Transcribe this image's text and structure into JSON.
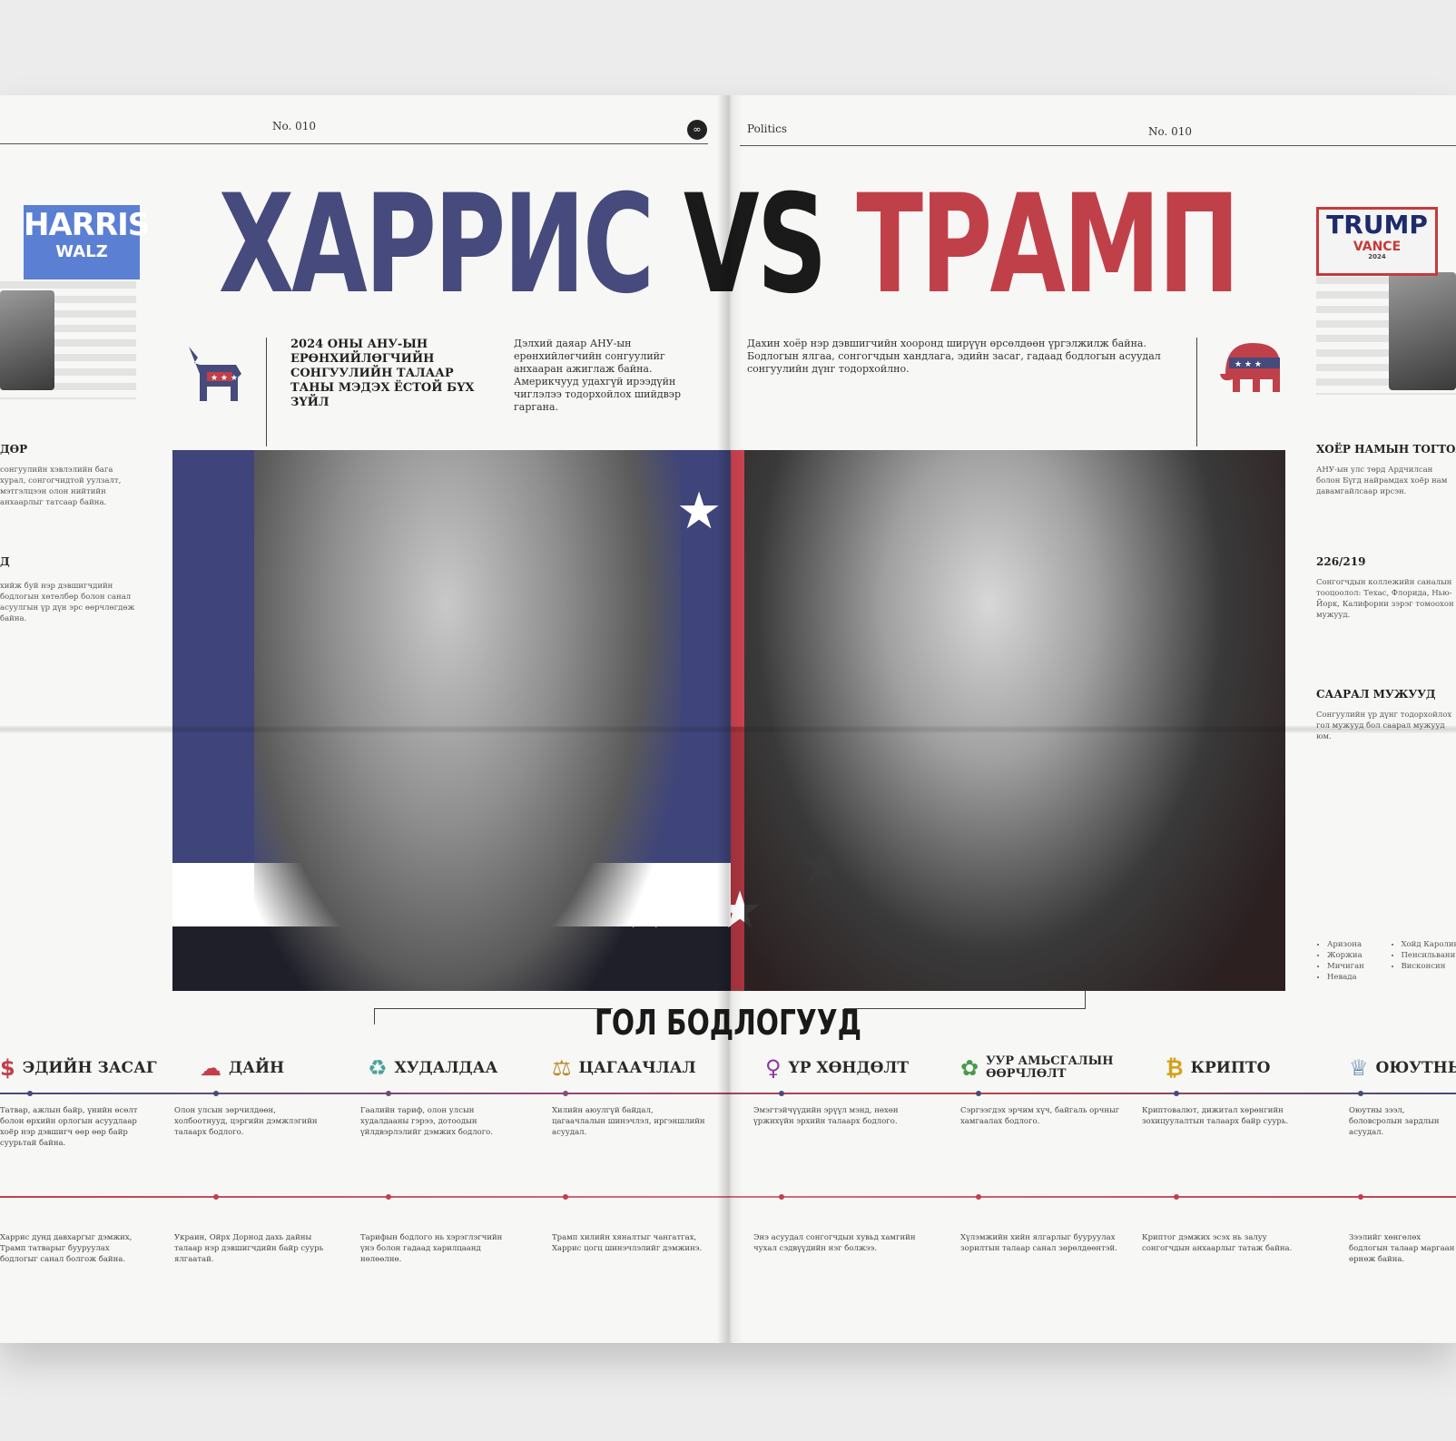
{
  "header": {
    "left_issue": "No. 010",
    "right_section": "Politics",
    "right_issue": "No. 010",
    "logo_glyph": "∞"
  },
  "title": {
    "harris": "ХАРРИС",
    "vs": "VS",
    "trump": "ТРАМП"
  },
  "signs": {
    "harris_line1": "HARRIS",
    "harris_line2": "WALZ",
    "trump_line1": "TRUMP",
    "trump_line2": "VANCE",
    "trump_line3": "2024"
  },
  "headline": "2024 ОНЫ АНУ-ЫН ЕРӨНХИЙЛӨГЧИЙН СОНГУУЛИЙН ТАЛААР ТАНЫ МЭДЭХ ЁСТОЙ БҮХ ЗҮЙЛ",
  "intro_left": "Дэлхий даяар АНУ-ын ерөнхийлөгчийн сонгуулийг анхааран ажиглаж байна. Америкчууд удахгүй ирээдүйн чиглэлээ тодорхойлох шийдвэр гаргана.",
  "intro_right": "Дахин хоёр нэр дэвшигчийн хооронд ширүүн өрсөлдөөн үргэлжилж байна. Бодлогын ялгаа, сонгогчдын хандлага, эдийн засаг, гадаад бодлогын асуудал сонгуулийн дүнг тодорхойлно.",
  "section_title": "ГОЛ БОДЛОГУУД",
  "policies": [
    {
      "icon": "$",
      "label": "ЭДИЙН ЗАСАГ",
      "text_top": "Татвар, ажлын байр, үнийн өсөлт болон өрхийн орлогын асуудлаар хоёр нэр дэвшигч өөр өөр байр суурьтай байна.",
      "text_bottom": "Харрис дунд давхаргыг дэмжих, Трамп татварыг бууруулах бодлогыг санал болгож байна."
    },
    {
      "icon": "☁",
      "label": "ДАЙН",
      "text_top": "Олон улсын зөрчилдөөн, холбоотнууд, цэргийн дэмжлэгийн талаарх бодлого.",
      "text_bottom": "Украин, Ойрх Дорнод дахь дайны талаар нэр дэвшигчдийн байр суурь ялгаатай."
    },
    {
      "icon": "♻",
      "label": "ХУДАЛДАА",
      "text_top": "Гаалийн тариф, олон улсын худалдааны гэрээ, дотоодын үйлдвэрлэлийг дэмжих бодлого.",
      "text_bottom": "Тарифын бодлого нь хэрэглэгчийн үнэ болон гадаад харилцаанд нөлөөлнө."
    },
    {
      "icon": "⚖",
      "label": "ЦАГААЧЛАЛ",
      "text_top": "Хилийн аюулгүй байдал, цагаачлалын шинэчлэл, иргэншлийн асуудал.",
      "text_bottom": "Трамп хилийн хяналтыг чангатгах, Харрис цогц шинэчлэлийг дэмжинэ."
    },
    {
      "icon": "♀",
      "label": "ҮР ХӨНДӨЛТ",
      "text_top": "Эмэгтэйчүүдийн эрүүл мэнд, нөхөн үржихүйн эрхийн талаарх бодлого.",
      "text_bottom": "Энэ асуудал сонгогчдын хувьд хамгийн чухал сэдвүүдийн нэг болжээ."
    },
    {
      "icon": "✿",
      "label": "УУР АМЬСГАЛЫН ӨӨРЧЛӨЛТ",
      "text_top": "Сэргээгдэх эрчим хүч, байгаль орчныг хамгаалах бодлого.",
      "text_bottom": "Хүлэмжийн хийн ялгарлыг бууруулах зорилтын талаар санал зөрөлдөөнтэй."
    },
    {
      "icon": "₿",
      "label": "КРИПТО",
      "text_top": "Криптовалют, дижитал хөрөнгийн зохицуулалтын талаарх байр суурь.",
      "text_bottom": "Криптог дэмжих эсэх нь залуу сонгогчдын анхаарлыг татаж байна."
    },
    {
      "icon": "♕",
      "label": "ОЮУТНЫ",
      "text_top": "Оюутны зээл, боловсролын зардлын асуудал.",
      "text_bottom": "Зээлийг хөнгөлөх бодлогын талаар маргаан өрнөж байна."
    }
  ],
  "left_sidebar": {
    "h1": "ДӨР",
    "h2": "Д",
    "text1": "сонгуулийн хэвлэлийн бага хурал, сонгогчидтой уулзалт, мэтгэлцээн олон нийтийн анхаарлыг татсаар байна.",
    "text2": "хийж буй нэр дэвшигчдийн бодлогын хөтөлбөр болон санал асуулгын үр дүн эрс өөрчлөгдөж байна."
  },
  "right_sidebar": {
    "h1": "ХОЁР НАМЫН ТОГТОЛ",
    "h2": "226/219",
    "h3": "СААРАЛ МУЖУУД",
    "text1": "АНУ-ын улс төрд Ардчилсан болон Бүгд найрамдах хоёр нам давамгайлсаар ирсэн.",
    "text2": "Сонгогчдын коллежийн саналын тооцоолол: Техас, Флорида, Нью-Йорк, Калифорни зэрэг томоохон мужууд.",
    "text3": "Сонгуулийн үр дүнг тодорхойлох гол мужууд бол саарал мужууд юм.",
    "list": [
      "Аризона",
      "Жоржиа",
      "Мичиган",
      "Невада",
      "Хойд Каролина",
      "Пенсильвани",
      "Висконсин"
    ]
  },
  "colors": {
    "democrat": "#464a7c",
    "republican": "#c0404a",
    "paper": "#f7f7f5"
  },
  "icons": {
    "democrat_symbol": "donkey-icon",
    "republican_symbol": "elephant-icon",
    "hero_star": "star-icon"
  }
}
